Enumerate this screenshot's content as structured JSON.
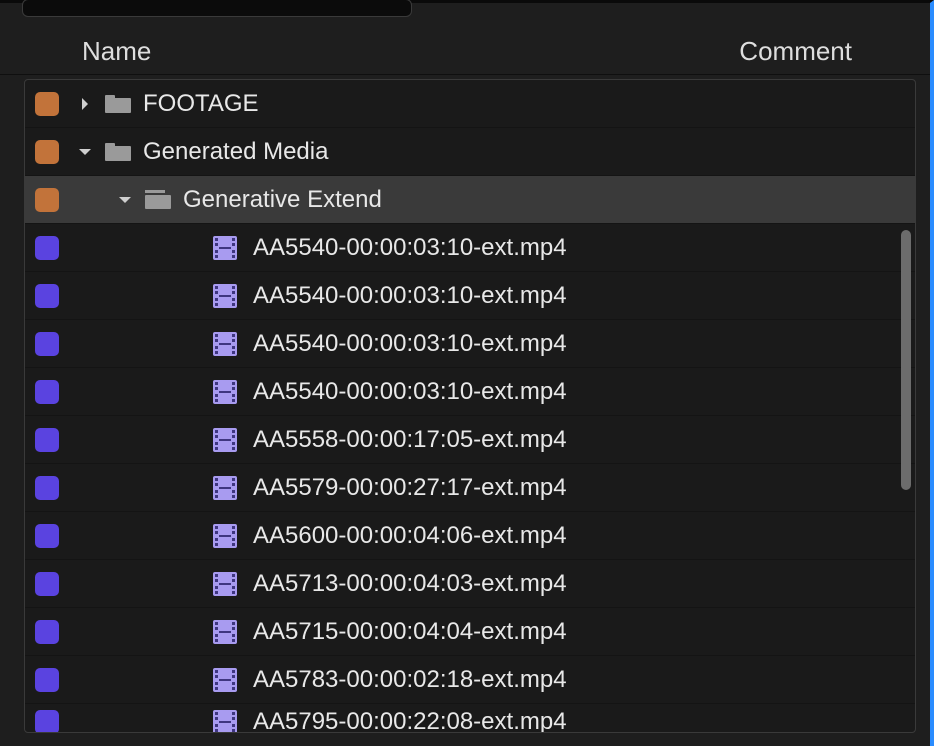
{
  "headers": {
    "name": "Name",
    "comment": "Comment"
  },
  "colors": {
    "orange": "#c2733a",
    "violet": "#5a43e0"
  },
  "rows": [
    {
      "kind": "bin",
      "swatch": "orange",
      "expanded": false,
      "depth": 0,
      "label": "FOOTAGE",
      "selected": false
    },
    {
      "kind": "bin",
      "swatch": "orange",
      "expanded": true,
      "depth": 0,
      "label": "Generated Media",
      "selected": false
    },
    {
      "kind": "bin",
      "swatch": "orange",
      "expanded": true,
      "depth": 1,
      "label": "Generative Extend",
      "selected": true
    },
    {
      "kind": "clip",
      "swatch": "violet",
      "depth": 2,
      "label": "AA5540-00:00:03:10-ext.mp4"
    },
    {
      "kind": "clip",
      "swatch": "violet",
      "depth": 2,
      "label": "AA5540-00:00:03:10-ext.mp4"
    },
    {
      "kind": "clip",
      "swatch": "violet",
      "depth": 2,
      "label": "AA5540-00:00:03:10-ext.mp4"
    },
    {
      "kind": "clip",
      "swatch": "violet",
      "depth": 2,
      "label": "AA5540-00:00:03:10-ext.mp4"
    },
    {
      "kind": "clip",
      "swatch": "violet",
      "depth": 2,
      "label": "AA5558-00:00:17:05-ext.mp4"
    },
    {
      "kind": "clip",
      "swatch": "violet",
      "depth": 2,
      "label": "AA5579-00:00:27:17-ext.mp4"
    },
    {
      "kind": "clip",
      "swatch": "violet",
      "depth": 2,
      "label": "AA5600-00:00:04:06-ext.mp4"
    },
    {
      "kind": "clip",
      "swatch": "violet",
      "depth": 2,
      "label": "AA5713-00:00:04:03-ext.mp4"
    },
    {
      "kind": "clip",
      "swatch": "violet",
      "depth": 2,
      "label": "AA5715-00:00:04:04-ext.mp4"
    },
    {
      "kind": "clip",
      "swatch": "violet",
      "depth": 2,
      "label": "AA5783-00:00:02:18-ext.mp4"
    },
    {
      "kind": "clip",
      "swatch": "violet",
      "depth": 2,
      "label": "AA5795-00:00:22:08-ext.mp4",
      "partial": true
    }
  ]
}
